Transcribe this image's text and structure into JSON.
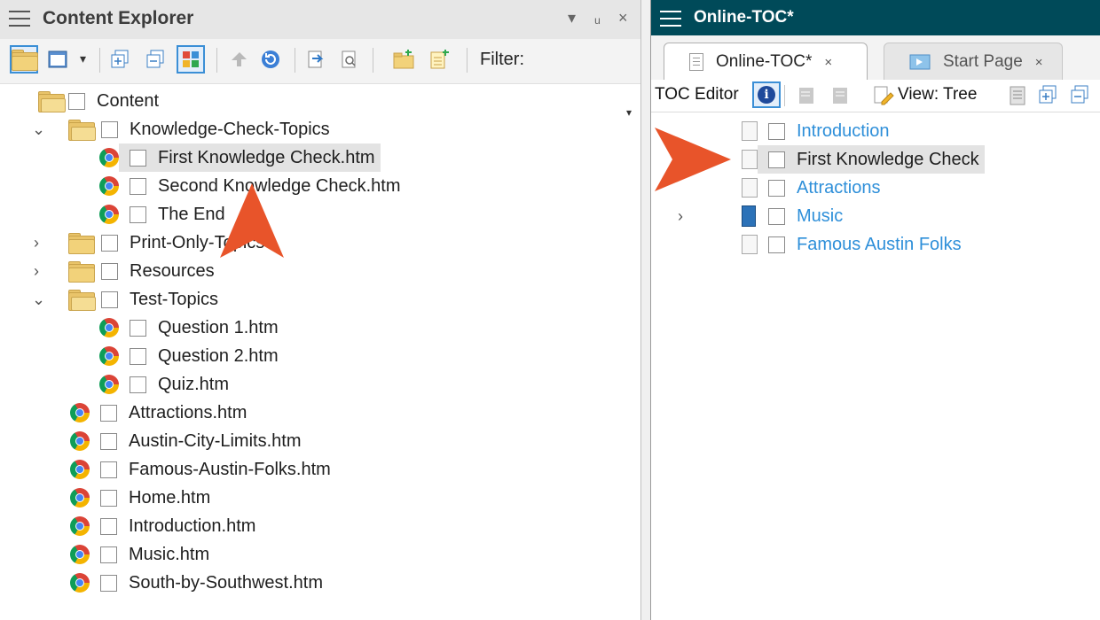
{
  "content_explorer": {
    "title": "Content Explorer",
    "controls": {
      "dropdown": "▾",
      "pin": "ᚁ",
      "close": "×"
    },
    "filter_label": "Filter:",
    "tree": [
      {
        "label": "Content",
        "icon": "folder-open-icon",
        "expanded": true
      },
      {
        "label": "Knowledge-Check-Topics",
        "icon": "folder-open-icon",
        "expanded": true
      },
      {
        "label": "First Knowledge Check.htm",
        "icon": "chrome-icon",
        "selected": true
      },
      {
        "label": "Second Knowledge Check.htm",
        "icon": "chrome-icon"
      },
      {
        "label": "The End",
        "icon": "chrome-icon"
      },
      {
        "label": "Print-Only-Topics",
        "icon": "folder-icon",
        "expanded": false
      },
      {
        "label": "Resources",
        "icon": "folder-icon",
        "expanded": false
      },
      {
        "label": "Test-Topics",
        "icon": "folder-open-icon",
        "expanded": true
      },
      {
        "label": "Question 1.htm",
        "icon": "chrome-icon"
      },
      {
        "label": "Question 2.htm",
        "icon": "chrome-icon"
      },
      {
        "label": "Quiz.htm",
        "icon": "chrome-icon"
      },
      {
        "label": "Attractions.htm",
        "icon": "chrome-icon"
      },
      {
        "label": "Austin-City-Limits.htm",
        "icon": "chrome-icon"
      },
      {
        "label": "Famous-Austin-Folks.htm",
        "icon": "chrome-icon"
      },
      {
        "label": "Home.htm",
        "icon": "chrome-icon"
      },
      {
        "label": "Introduction.htm",
        "icon": "chrome-icon"
      },
      {
        "label": "Music.htm",
        "icon": "chrome-icon"
      },
      {
        "label": "South-by-Southwest.htm",
        "icon": "chrome-icon"
      }
    ]
  },
  "toc_editor": {
    "title": "Online-TOC*",
    "tabs": [
      {
        "label": "Online-TOC*",
        "close": "×",
        "active": true
      },
      {
        "label": "Start Page",
        "close": "×",
        "active": false
      }
    ],
    "toolbar_label": "TOC Editor",
    "view_label": "View: Tree",
    "items": [
      {
        "label": "Introduction",
        "icon": "page-icon",
        "link": true
      },
      {
        "label": "First Knowledge Check",
        "icon": "page-icon",
        "link": false,
        "selected": true
      },
      {
        "label": "Attractions",
        "icon": "page-icon",
        "link": true
      },
      {
        "label": "Music",
        "icon": "book-icon",
        "link": true,
        "expandable": true
      },
      {
        "label": "Famous Austin Folks",
        "icon": "page-icon",
        "link": true
      }
    ]
  },
  "colors": {
    "annotation_arrow": "#e8542a",
    "link": "#2e8fd9",
    "toc_title_bar": "#004a59",
    "selection": "#e3e3e3"
  }
}
